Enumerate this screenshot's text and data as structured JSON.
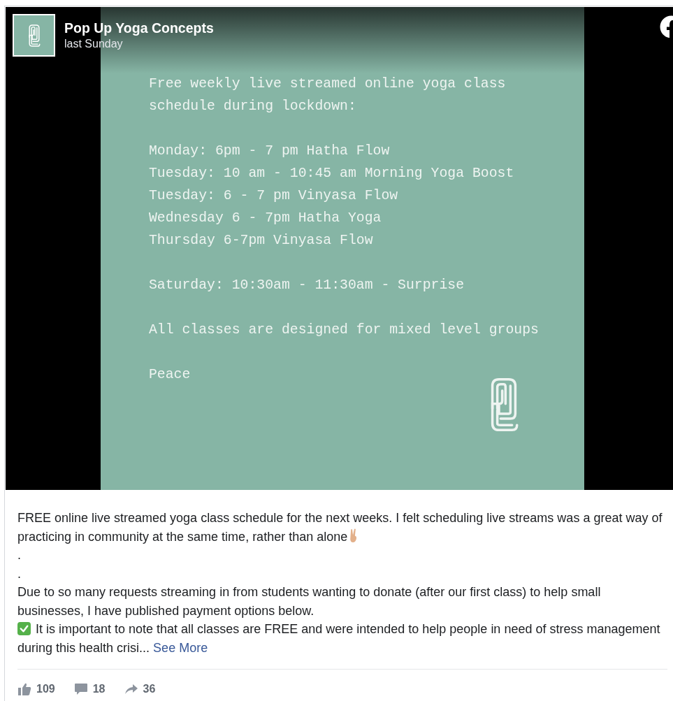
{
  "post": {
    "page_name": "Pop Up Yoga Concepts",
    "time": "last Sunday"
  },
  "poster": {
    "blocks": [
      {
        "lines": [
          "Free weekly live streamed online yoga class schedule during lockdown:"
        ]
      },
      {
        "lines": [
          "Monday: 6pm - 7 pm Hatha Flow",
          "Tuesday: 10 am - 10:45 am Morning Yoga Boost",
          "Tuesday: 6 - 7 pm Vinyasa Flow",
          "Wednesday 6 - 7pm Hatha Yoga",
          "Thursday 6-7pm Vinyasa Flow"
        ]
      },
      {
        "lines": [
          "Saturday: 10:30am - 11:30am - Surprise"
        ]
      },
      {
        "lines": [
          "All classes are designed for mixed level groups"
        ]
      },
      {
        "lines": [
          "Peace"
        ]
      }
    ]
  },
  "caption": {
    "paragraphs": [
      {
        "kind": "text_with_trailing_emoji",
        "text": "FREE online live streamed yoga class schedule for the next weeks. I felt scheduling live streams was a great way of practicing in community at the same time, rather than alone"
      },
      {
        "kind": "text",
        "text": "."
      },
      {
        "kind": "text",
        "text": "."
      },
      {
        "kind": "text",
        "text": "Due to so many requests streaming in from students wanting to donate (after our first class) to help small businesses, I have published payment options below."
      },
      {
        "kind": "text_with_leading_emoji",
        "text": "It is important to note that all classes are FREE and were intended to help people in need of stress management during this health crisi..."
      }
    ],
    "see_more": "See More"
  },
  "actions": [
    {
      "kind": "like",
      "count": "109"
    },
    {
      "kind": "comment",
      "count": "18"
    },
    {
      "kind": "share",
      "count": "36"
    }
  ]
}
